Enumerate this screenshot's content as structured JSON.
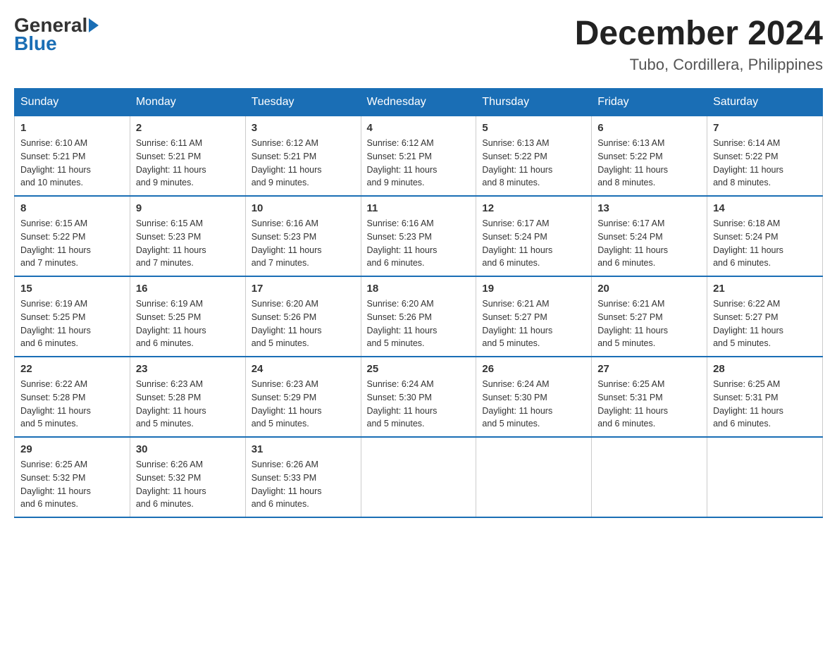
{
  "logo": {
    "general": "General",
    "blue": "Blue"
  },
  "title": "December 2024",
  "location": "Tubo, Cordillera, Philippines",
  "days_of_week": [
    "Sunday",
    "Monday",
    "Tuesday",
    "Wednesday",
    "Thursday",
    "Friday",
    "Saturday"
  ],
  "weeks": [
    [
      {
        "day": "1",
        "sunrise": "6:10 AM",
        "sunset": "5:21 PM",
        "daylight": "11 hours and 10 minutes."
      },
      {
        "day": "2",
        "sunrise": "6:11 AM",
        "sunset": "5:21 PM",
        "daylight": "11 hours and 9 minutes."
      },
      {
        "day": "3",
        "sunrise": "6:12 AM",
        "sunset": "5:21 PM",
        "daylight": "11 hours and 9 minutes."
      },
      {
        "day": "4",
        "sunrise": "6:12 AM",
        "sunset": "5:21 PM",
        "daylight": "11 hours and 9 minutes."
      },
      {
        "day": "5",
        "sunrise": "6:13 AM",
        "sunset": "5:22 PM",
        "daylight": "11 hours and 8 minutes."
      },
      {
        "day": "6",
        "sunrise": "6:13 AM",
        "sunset": "5:22 PM",
        "daylight": "11 hours and 8 minutes."
      },
      {
        "day": "7",
        "sunrise": "6:14 AM",
        "sunset": "5:22 PM",
        "daylight": "11 hours and 8 minutes."
      }
    ],
    [
      {
        "day": "8",
        "sunrise": "6:15 AM",
        "sunset": "5:22 PM",
        "daylight": "11 hours and 7 minutes."
      },
      {
        "day": "9",
        "sunrise": "6:15 AM",
        "sunset": "5:23 PM",
        "daylight": "11 hours and 7 minutes."
      },
      {
        "day": "10",
        "sunrise": "6:16 AM",
        "sunset": "5:23 PM",
        "daylight": "11 hours and 7 minutes."
      },
      {
        "day": "11",
        "sunrise": "6:16 AM",
        "sunset": "5:23 PM",
        "daylight": "11 hours and 6 minutes."
      },
      {
        "day": "12",
        "sunrise": "6:17 AM",
        "sunset": "5:24 PM",
        "daylight": "11 hours and 6 minutes."
      },
      {
        "day": "13",
        "sunrise": "6:17 AM",
        "sunset": "5:24 PM",
        "daylight": "11 hours and 6 minutes."
      },
      {
        "day": "14",
        "sunrise": "6:18 AM",
        "sunset": "5:24 PM",
        "daylight": "11 hours and 6 minutes."
      }
    ],
    [
      {
        "day": "15",
        "sunrise": "6:19 AM",
        "sunset": "5:25 PM",
        "daylight": "11 hours and 6 minutes."
      },
      {
        "day": "16",
        "sunrise": "6:19 AM",
        "sunset": "5:25 PM",
        "daylight": "11 hours and 6 minutes."
      },
      {
        "day": "17",
        "sunrise": "6:20 AM",
        "sunset": "5:26 PM",
        "daylight": "11 hours and 5 minutes."
      },
      {
        "day": "18",
        "sunrise": "6:20 AM",
        "sunset": "5:26 PM",
        "daylight": "11 hours and 5 minutes."
      },
      {
        "day": "19",
        "sunrise": "6:21 AM",
        "sunset": "5:27 PM",
        "daylight": "11 hours and 5 minutes."
      },
      {
        "day": "20",
        "sunrise": "6:21 AM",
        "sunset": "5:27 PM",
        "daylight": "11 hours and 5 minutes."
      },
      {
        "day": "21",
        "sunrise": "6:22 AM",
        "sunset": "5:27 PM",
        "daylight": "11 hours and 5 minutes."
      }
    ],
    [
      {
        "day": "22",
        "sunrise": "6:22 AM",
        "sunset": "5:28 PM",
        "daylight": "11 hours and 5 minutes."
      },
      {
        "day": "23",
        "sunrise": "6:23 AM",
        "sunset": "5:28 PM",
        "daylight": "11 hours and 5 minutes."
      },
      {
        "day": "24",
        "sunrise": "6:23 AM",
        "sunset": "5:29 PM",
        "daylight": "11 hours and 5 minutes."
      },
      {
        "day": "25",
        "sunrise": "6:24 AM",
        "sunset": "5:30 PM",
        "daylight": "11 hours and 5 minutes."
      },
      {
        "day": "26",
        "sunrise": "6:24 AM",
        "sunset": "5:30 PM",
        "daylight": "11 hours and 5 minutes."
      },
      {
        "day": "27",
        "sunrise": "6:25 AM",
        "sunset": "5:31 PM",
        "daylight": "11 hours and 6 minutes."
      },
      {
        "day": "28",
        "sunrise": "6:25 AM",
        "sunset": "5:31 PM",
        "daylight": "11 hours and 6 minutes."
      }
    ],
    [
      {
        "day": "29",
        "sunrise": "6:25 AM",
        "sunset": "5:32 PM",
        "daylight": "11 hours and 6 minutes."
      },
      {
        "day": "30",
        "sunrise": "6:26 AM",
        "sunset": "5:32 PM",
        "daylight": "11 hours and 6 minutes."
      },
      {
        "day": "31",
        "sunrise": "6:26 AM",
        "sunset": "5:33 PM",
        "daylight": "11 hours and 6 minutes."
      },
      null,
      null,
      null,
      null
    ]
  ],
  "labels": {
    "sunrise": "Sunrise:",
    "sunset": "Sunset:",
    "daylight": "Daylight:"
  }
}
